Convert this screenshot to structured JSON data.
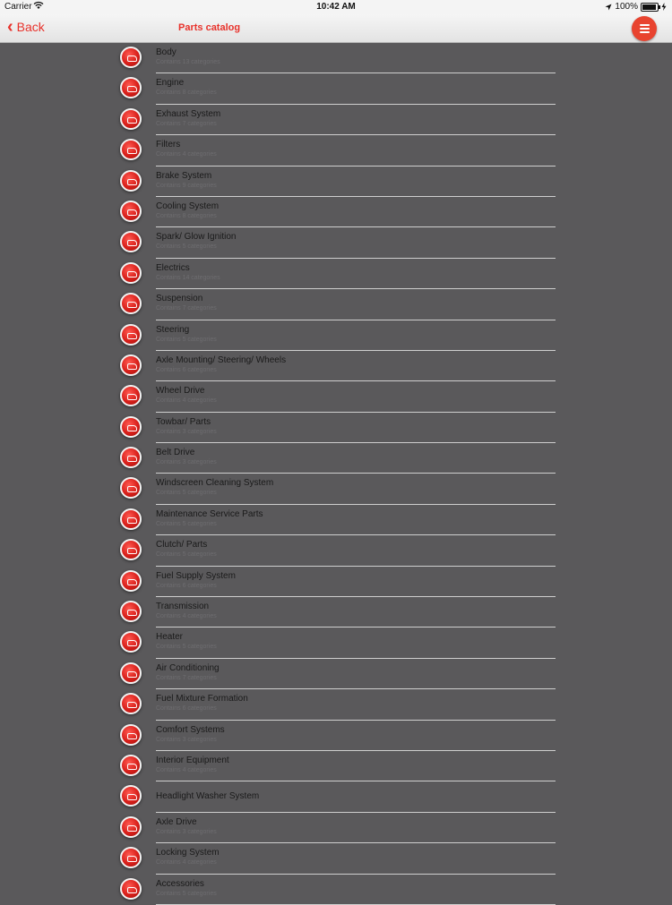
{
  "status_bar": {
    "carrier": "Carrier",
    "time": "10:42 AM",
    "battery": "100%"
  },
  "nav": {
    "back_label": "Back",
    "title": "Parts catalog",
    "accent_color": "#e8322b"
  },
  "items": [
    {
      "title": "Body",
      "subtitle": "Contains 13 categories"
    },
    {
      "title": "Engine",
      "subtitle": "Contains 8 categories"
    },
    {
      "title": "Exhaust System",
      "subtitle": "Contains 7 categories"
    },
    {
      "title": "Filters",
      "subtitle": "Contains 4 categories"
    },
    {
      "title": "Brake System",
      "subtitle": "Contains 9 categories"
    },
    {
      "title": "Cooling System",
      "subtitle": "Contains 8 categories"
    },
    {
      "title": "Spark/ Glow Ignition",
      "subtitle": "Contains 5 categories"
    },
    {
      "title": "Electrics",
      "subtitle": "Contains 14 categories"
    },
    {
      "title": "Suspension",
      "subtitle": "Contains 7 categories"
    },
    {
      "title": "Steering",
      "subtitle": "Contains 5 categories"
    },
    {
      "title": "Axle Mounting/ Steering/ Wheels",
      "subtitle": "Contains 6 categories"
    },
    {
      "title": "Wheel Drive",
      "subtitle": "Contains 4 categories"
    },
    {
      "title": "Towbar/ Parts",
      "subtitle": "Contains 3 categories"
    },
    {
      "title": "Belt Drive",
      "subtitle": "Contains 3 categories"
    },
    {
      "title": "Windscreen Cleaning System",
      "subtitle": "Contains 5 categories"
    },
    {
      "title": "Maintenance Service Parts",
      "subtitle": "Contains 5 categories"
    },
    {
      "title": "Clutch/ Parts",
      "subtitle": "Contains 5 categories"
    },
    {
      "title": "Fuel Supply System",
      "subtitle": "Contains 6 categories"
    },
    {
      "title": "Transmission",
      "subtitle": "Contains 4 categories"
    },
    {
      "title": "Heater",
      "subtitle": "Contains 5 categories"
    },
    {
      "title": "Air Conditioning",
      "subtitle": "Contains 7 categories"
    },
    {
      "title": "Fuel Mixture Formation",
      "subtitle": "Contains 6 categories"
    },
    {
      "title": "Comfort Systems",
      "subtitle": "Contains 3 categories"
    },
    {
      "title": "Interior Equipment",
      "subtitle": "Contains 4 categories"
    },
    {
      "title": "Headlight Washer System",
      "subtitle": ""
    },
    {
      "title": "Axle Drive",
      "subtitle": "Contains 3 categories"
    },
    {
      "title": "Locking System",
      "subtitle": "Contains 4 categories"
    },
    {
      "title": "Accessories",
      "subtitle": "Contains 5 categories"
    }
  ]
}
